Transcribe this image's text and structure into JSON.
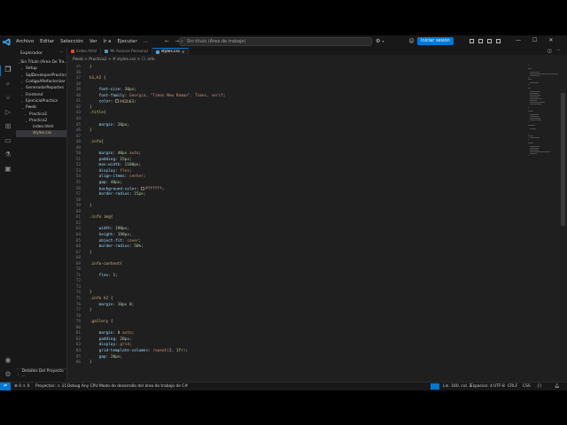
{
  "menu": [
    "Archivo",
    "Editar",
    "Selección",
    "Ver",
    "Ir a",
    "Ejecutar",
    "..."
  ],
  "command_center": {
    "text": "Sin título (Área de trabajo)"
  },
  "signin_label": "Iniciar sesión",
  "sidebar": {
    "title": "Explorador",
    "items": [
      {
        "label": "Sin Título (Área De Tra...",
        "indent": 1,
        "open": true
      },
      {
        "label": "Setup",
        "indent": 2,
        "open": false
      },
      {
        "label": "SqlDeveloperPractica",
        "indent": 2,
        "open": false
      },
      {
        "label": "CodigoARefactorizar",
        "indent": 2,
        "open": false
      },
      {
        "label": "GeneradorReportes",
        "indent": 2,
        "open": false
      },
      {
        "label": "Frontend",
        "indent": 2,
        "open": false
      },
      {
        "label": "EjercicioPractica",
        "indent": 2,
        "open": false
      },
      {
        "label": "Pweb",
        "indent": 2,
        "open": true
      },
      {
        "label": "Practica1",
        "indent": 3,
        "open": false
      },
      {
        "label": "Practica2",
        "indent": 3,
        "open": true
      },
      {
        "label": "index.html",
        "indent": 4,
        "file": true
      },
      {
        "label": "styles.css",
        "indent": 4,
        "file": true,
        "selected": true
      }
    ],
    "bottom": "Detalles Del Proyecto ..."
  },
  "tabs": [
    {
      "label": "index.html",
      "color": "#e44d26",
      "active": false
    },
    {
      "label": "Mi Avance Personal",
      "color": "#519aba",
      "active": false
    },
    {
      "label": "styles.css",
      "color": "#42a5f5",
      "active": true
    }
  ],
  "breadcrumb": "Pweb > Practica2 > # styles.css > ☐ .info",
  "code_lines": [
    {
      "n": "35",
      "t": "}"
    },
    {
      "n": "36",
      "t": ""
    },
    {
      "n": "37",
      "t": "h1,h2 {"
    },
    {
      "n": "38",
      "t": ""
    },
    {
      "n": "39",
      "t": "    font-size: 30px;"
    },
    {
      "n": "40",
      "t": "    font-family: Georgia, \"Times New Roman\", Times, serif;"
    },
    {
      "n": "41",
      "t": "    color: ▢#43b63;"
    },
    {
      "n": "42",
      "t": "}"
    },
    {
      "n": "43",
      "t": ".title{"
    },
    {
      "n": "44",
      "t": ""
    },
    {
      "n": "45",
      "t": "    margin: 20px;"
    },
    {
      "n": "46",
      "t": "}"
    },
    {
      "n": "47",
      "t": ""
    },
    {
      "n": "48",
      "t": ".info{"
    },
    {
      "n": "49",
      "t": ""
    },
    {
      "n": "50",
      "t": "    margin: 40px auto;"
    },
    {
      "n": "51",
      "t": "    padding: 15px;"
    },
    {
      "n": "52",
      "t": "    max-width: 1100px;"
    },
    {
      "n": "53",
      "t": "    display: flex;"
    },
    {
      "n": "54",
      "t": "    align-items: center;"
    },
    {
      "n": "55",
      "t": "    gap: 40px;"
    },
    {
      "n": "56",
      "t": "    background-color: ▢#ffffff;"
    },
    {
      "n": "57",
      "t": "    border-radius: 15px;"
    },
    {
      "n": "58",
      "t": ""
    },
    {
      "n": "59",
      "t": "}"
    },
    {
      "n": "60",
      "t": ""
    },
    {
      "n": "61",
      "t": ".info img{"
    },
    {
      "n": "62",
      "t": ""
    },
    {
      "n": "63",
      "t": "    width: 190px;"
    },
    {
      "n": "64",
      "t": "    height: 190px;"
    },
    {
      "n": "65",
      "t": "    object-fit: cover;"
    },
    {
      "n": "66",
      "t": "    border-radius: 50%;"
    },
    {
      "n": "67",
      "t": "}"
    },
    {
      "n": "68",
      "t": ""
    },
    {
      "n": "69",
      "t": ".info-content{"
    },
    {
      "n": "70",
      "t": ""
    },
    {
      "n": "71",
      "t": "    flex: 1;"
    },
    {
      "n": "72",
      "t": ""
    },
    {
      "n": "73",
      "t": ""
    },
    {
      "n": "74",
      "t": "}"
    },
    {
      "n": "75",
      "t": ".info h2 {"
    },
    {
      "n": "76",
      "t": "    margin: 10px 0;"
    },
    {
      "n": "77",
      "t": "}"
    },
    {
      "n": "78",
      "t": ""
    },
    {
      "n": "79",
      "t": ".gallery {"
    },
    {
      "n": "80",
      "t": ""
    },
    {
      "n": "81",
      "t": "    margin: 0 auto;"
    },
    {
      "n": "82",
      "t": "    padding: 20px;"
    },
    {
      "n": "83",
      "t": "    display: grid;"
    },
    {
      "n": "84",
      "t": "    grid-template-columns: repeat(2, 1fr);"
    },
    {
      "n": "85",
      "t": "    gap: 20px;"
    },
    {
      "n": "86",
      "t": "}"
    }
  ],
  "status": {
    "errors": "⊗ 0 ⚠ 0",
    "projects": "Proyectos: ⚠ 11",
    "debug": "Debug Any CPU",
    "mode": "Modo de desarrollo del área de trabajo de C#",
    "position": "Lín. 160, col. 2",
    "spaces": "Espacios: 4",
    "encoding": "UTF-8",
    "eol": "CRLF",
    "lang": "CSS"
  }
}
